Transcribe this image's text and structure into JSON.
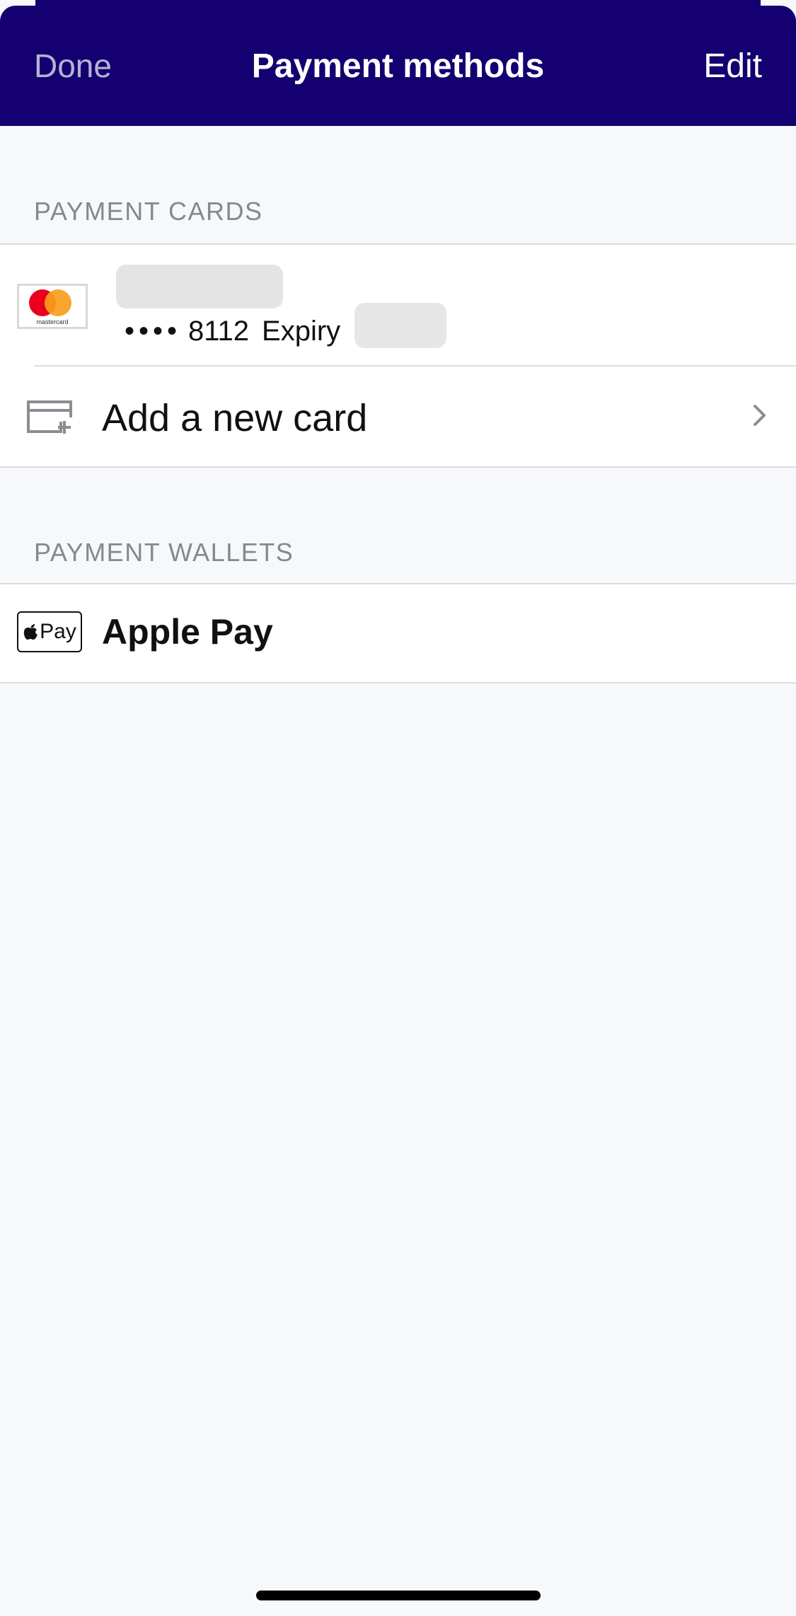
{
  "nav": {
    "done_label": "Done",
    "title": "Payment methods",
    "edit_label": "Edit"
  },
  "payment_cards": {
    "header": "PAYMENT CARDS",
    "cards": [
      {
        "brand": "mastercard",
        "brand_text": "mastercard",
        "masked_digits": "••••",
        "last4": "8112",
        "expiry_label": "Expiry"
      }
    ],
    "add_card_label": "Add a new card",
    "icons": {
      "card_brand": "mastercard-icon",
      "add_card": "add-card-icon",
      "chevron": "chevron-right-icon"
    }
  },
  "payment_wallets": {
    "header": "PAYMENT WALLETS",
    "wallets": [
      {
        "name": "Apple Pay",
        "badge_text": "Pay",
        "icon": "apple-pay-icon"
      }
    ]
  },
  "colors": {
    "nav_background": "#140070",
    "nav_done": "#b5b2d4",
    "page_background": "#f7f8fa",
    "section_header": "#85888d",
    "separator": "#dcdde0",
    "mastercard_red": "#eb001b",
    "mastercard_orange": "#f79e1b"
  }
}
